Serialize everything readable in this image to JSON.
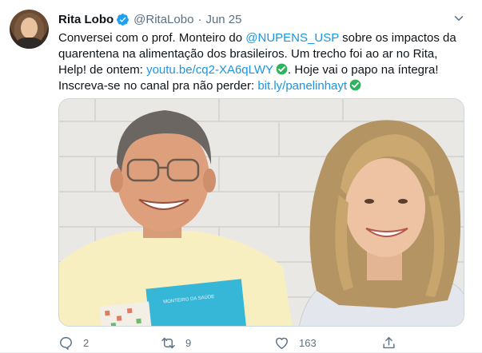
{
  "tweet": {
    "author_name": "Rita Lobo",
    "handle": "@RitaLobo",
    "separator": "·",
    "date": "Jun 25",
    "text_parts": {
      "p1": "Conversei com o prof. Monteiro do ",
      "mention": "@NUPENS_USP",
      "p2": " sobre os impactos da quarentena na alimentação dos brasileiros. Um trecho foi ao ar no Rita, Help! de ontem: ",
      "link1": "youtu.be/cq2-XA6qLWY",
      "p3": ". Hoje vai o papo na íntegra! Inscreva-se no canal pra não perder: ",
      "link2": "bit.ly/panelinhayt"
    },
    "media": {
      "book_text": "MONTEIRO DA SAÚDE"
    }
  },
  "actions": {
    "reply_count": "2",
    "retweet_count": "9",
    "like_count": "163"
  },
  "colors": {
    "link": "#1b95e0",
    "secondary_text": "#5b7083",
    "check_green": "#2fb35e",
    "verified_blue": "#1da1f2"
  },
  "icons": [
    "verified-badge-icon",
    "chevron-down-icon",
    "check-emoji-icon",
    "reply-icon",
    "retweet-icon",
    "like-icon",
    "share-icon"
  ]
}
